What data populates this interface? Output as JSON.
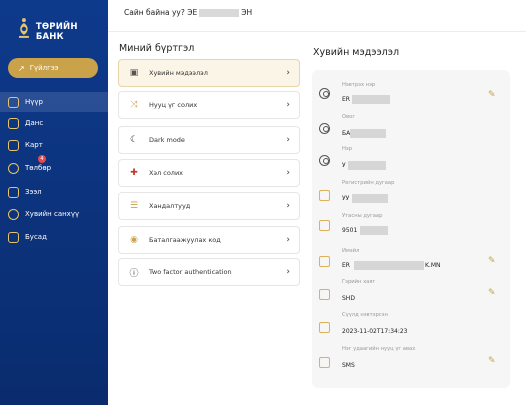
{
  "brand": {
    "name": "ТӨРИЙН БАНК",
    "accent": "#c9a24a",
    "sidebar_bg": "#0e3a8c"
  },
  "sidebar": {
    "primary_action": {
      "label": "Гүйлгээ",
      "icon": "arrow-up-right-icon"
    },
    "items": [
      {
        "label": "Нүүр",
        "icon": "home-icon",
        "selected": true
      },
      {
        "label": "Данс",
        "icon": "account-icon"
      },
      {
        "label": "Карт",
        "icon": "card-icon"
      },
      {
        "label": "Төлбөр",
        "icon": "bulb-icon",
        "badge": "4"
      },
      {
        "label": "Зээл",
        "icon": "loan-icon"
      },
      {
        "label": "Хувийн санхүү",
        "icon": "people-icon"
      },
      {
        "label": "Бусад",
        "icon": "grid-icon"
      }
    ]
  },
  "header": {
    "greeting_prefix": "Сайн байна уу? ЭЕ",
    "greeting_suffix": "ЭН"
  },
  "account_menu": {
    "title": "Миний бүртгэл",
    "items": [
      {
        "label": "Хувийн мэдээлэл",
        "icon": "id-card-icon",
        "active": true
      },
      {
        "label": "Нууц үг солих",
        "icon": "shuffle-icon"
      },
      {
        "label": "Dark mode",
        "icon": "moon-icon"
      },
      {
        "label": "Хэл солих",
        "icon": "flag-icon"
      },
      {
        "label": "Хандалтууд",
        "icon": "access-icon"
      },
      {
        "label": "Баталгаажуулах код",
        "icon": "shield-icon"
      },
      {
        "label": "Two factor authentication",
        "icon": "info-icon"
      }
    ]
  },
  "personal_info": {
    "title": "Хувийн мэдээлэл",
    "fields": [
      {
        "label": "Нэвтрэх нэр",
        "value": "ER",
        "icon": "user-icon",
        "editable": true
      },
      {
        "label": "Овог",
        "value": "БА",
        "icon": "user-icon",
        "editable": false
      },
      {
        "label": "Нэр",
        "value": "У",
        "icon": "user-icon",
        "editable": false
      },
      {
        "label": "Регистрийн дугаар",
        "value": "УУ",
        "icon": "card-icon",
        "editable": false
      },
      {
        "label": "Утасны дугаар",
        "value": "9501",
        "icon": "card-icon",
        "editable": false
      },
      {
        "label": "Имэйл",
        "value": "ER",
        "value_suffix": "K.MN",
        "icon": "card-icon",
        "editable": true
      },
      {
        "label": "Гэрийн хаяг",
        "value": "SHD",
        "icon": "card-icon",
        "editable": true
      },
      {
        "label": "Сүүлд нэвтэрсэн",
        "value": "2023-11-02T17:34:23",
        "icon": "card-icon",
        "editable": false
      },
      {
        "label": "Нэг удаагийн нууц үг авах",
        "value": "SMS",
        "icon": "card-icon",
        "editable": true
      }
    ]
  }
}
